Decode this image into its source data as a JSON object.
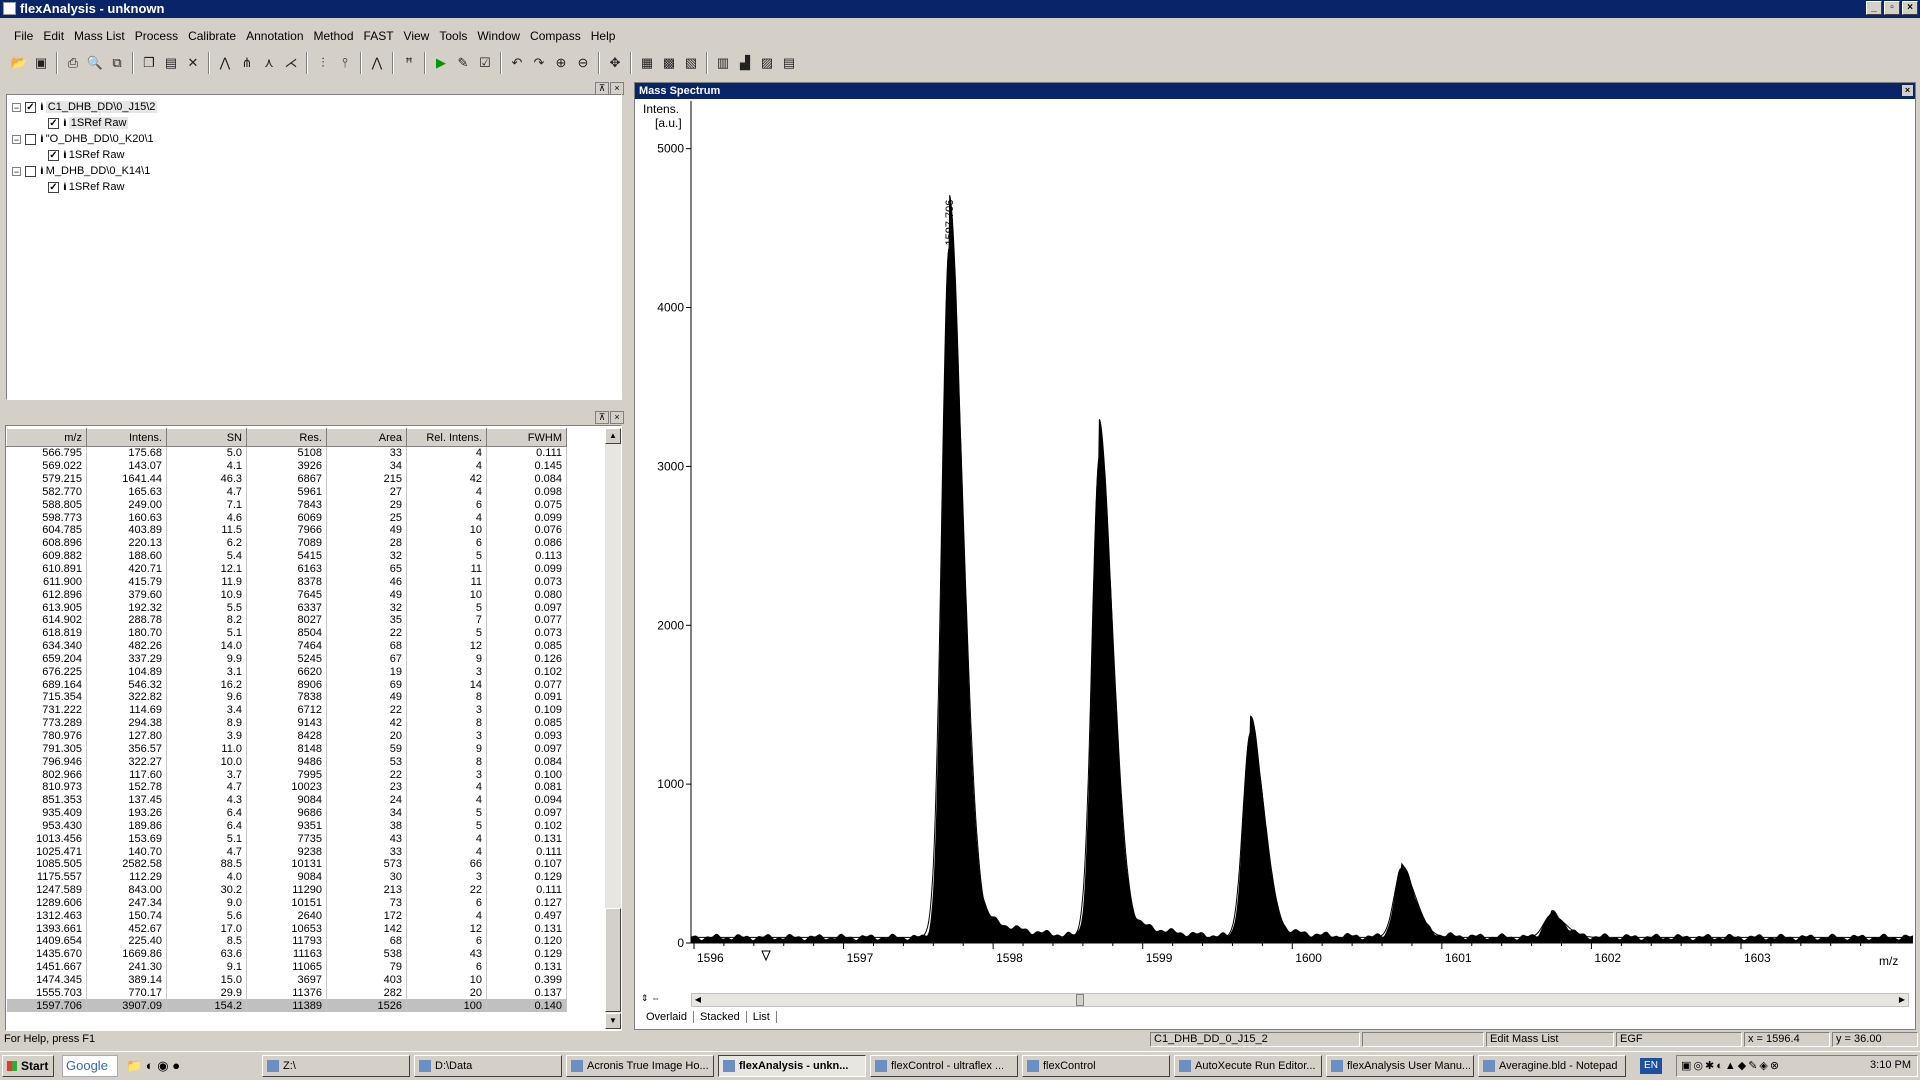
{
  "window": {
    "title": "flexAnalysis - unknown"
  },
  "menu": [
    "File",
    "Edit",
    "Mass List",
    "Process",
    "Calibrate",
    "Annotation",
    "Method",
    "FAST",
    "View",
    "Tools",
    "Window",
    "Compass",
    "Help"
  ],
  "tree": [
    {
      "name": "C1_DHB_DD\\0_J15\\2",
      "child": "1SRef Raw"
    },
    {
      "name": "\"O_DHB_DD\\0_K20\\1",
      "child": "1SRef Raw"
    },
    {
      "name": "M_DHB_DD\\0_K14\\1",
      "child": "1SRef Raw"
    }
  ],
  "peak_table": {
    "headers": [
      "m/z",
      "Intens.",
      "SN",
      "Res.",
      "Area",
      "Rel. Intens.",
      "FWHM"
    ],
    "rows": [
      [
        "566.795",
        "175.68",
        "5.0",
        "5108",
        "33",
        "4",
        "0.111"
      ],
      [
        "569.022",
        "143.07",
        "4.1",
        "3926",
        "34",
        "4",
        "0.145"
      ],
      [
        "579.215",
        "1641.44",
        "46.3",
        "6867",
        "215",
        "42",
        "0.084"
      ],
      [
        "582.770",
        "165.63",
        "4.7",
        "5961",
        "27",
        "4",
        "0.098"
      ],
      [
        "588.805",
        "249.00",
        "7.1",
        "7843",
        "29",
        "6",
        "0.075"
      ],
      [
        "598.773",
        "160.63",
        "4.6",
        "6069",
        "25",
        "4",
        "0.099"
      ],
      [
        "604.785",
        "403.89",
        "11.5",
        "7966",
        "49",
        "10",
        "0.076"
      ],
      [
        "608.896",
        "220.13",
        "6.2",
        "7089",
        "28",
        "6",
        "0.086"
      ],
      [
        "609.882",
        "188.60",
        "5.4",
        "5415",
        "32",
        "5",
        "0.113"
      ],
      [
        "610.891",
        "420.71",
        "12.1",
        "6163",
        "65",
        "11",
        "0.099"
      ],
      [
        "611.900",
        "415.79",
        "11.9",
        "8378",
        "46",
        "11",
        "0.073"
      ],
      [
        "612.896",
        "379.60",
        "10.9",
        "7645",
        "49",
        "10",
        "0.080"
      ],
      [
        "613.905",
        "192.32",
        "5.5",
        "6337",
        "32",
        "5",
        "0.097"
      ],
      [
        "614.902",
        "288.78",
        "8.2",
        "8027",
        "35",
        "7",
        "0.077"
      ],
      [
        "618.819",
        "180.70",
        "5.1",
        "8504",
        "22",
        "5",
        "0.073"
      ],
      [
        "634.340",
        "482.26",
        "14.0",
        "7464",
        "68",
        "12",
        "0.085"
      ],
      [
        "659.204",
        "337.29",
        "9.9",
        "5245",
        "67",
        "9",
        "0.126"
      ],
      [
        "676.225",
        "104.89",
        "3.1",
        "6620",
        "19",
        "3",
        "0.102"
      ],
      [
        "689.164",
        "546.32",
        "16.2",
        "8906",
        "69",
        "14",
        "0.077"
      ],
      [
        "715.354",
        "322.82",
        "9.6",
        "7838",
        "49",
        "8",
        "0.091"
      ],
      [
        "731.222",
        "114.69",
        "3.4",
        "6712",
        "22",
        "3",
        "0.109"
      ],
      [
        "773.289",
        "294.38",
        "8.9",
        "9143",
        "42",
        "8",
        "0.085"
      ],
      [
        "780.976",
        "127.80",
        "3.9",
        "8428",
        "20",
        "3",
        "0.093"
      ],
      [
        "791.305",
        "356.57",
        "11.0",
        "8148",
        "59",
        "9",
        "0.097"
      ],
      [
        "796.946",
        "322.27",
        "10.0",
        "9486",
        "53",
        "8",
        "0.084"
      ],
      [
        "802.966",
        "117.60",
        "3.7",
        "7995",
        "22",
        "3",
        "0.100"
      ],
      [
        "810.973",
        "152.78",
        "4.7",
        "10023",
        "23",
        "4",
        "0.081"
      ],
      [
        "851.353",
        "137.45",
        "4.3",
        "9084",
        "24",
        "4",
        "0.094"
      ],
      [
        "935.409",
        "193.26",
        "6.4",
        "9686",
        "34",
        "5",
        "0.097"
      ],
      [
        "953.430",
        "189.86",
        "6.4",
        "9351",
        "38",
        "5",
        "0.102"
      ],
      [
        "1013.456",
        "153.69",
        "5.1",
        "7735",
        "43",
        "4",
        "0.131"
      ],
      [
        "1025.471",
        "140.70",
        "4.7",
        "9238",
        "33",
        "4",
        "0.111"
      ],
      [
        "1085.505",
        "2582.58",
        "88.5",
        "10131",
        "573",
        "66",
        "0.107"
      ],
      [
        "1175.557",
        "112.29",
        "4.0",
        "9084",
        "30",
        "3",
        "0.129"
      ],
      [
        "1247.589",
        "843.00",
        "30.2",
        "11290",
        "213",
        "22",
        "0.111"
      ],
      [
        "1289.606",
        "247.34",
        "9.0",
        "10151",
        "73",
        "6",
        "0.127"
      ],
      [
        "1312.463",
        "150.74",
        "5.6",
        "2640",
        "172",
        "4",
        "0.497"
      ],
      [
        "1393.661",
        "452.67",
        "17.0",
        "10653",
        "142",
        "12",
        "0.131"
      ],
      [
        "1409.654",
        "225.40",
        "8.5",
        "11793",
        "68",
        "6",
        "0.120"
      ],
      [
        "1435.670",
        "1669.86",
        "63.6",
        "11163",
        "538",
        "43",
        "0.129"
      ],
      [
        "1451.667",
        "241.30",
        "9.1",
        "11065",
        "79",
        "6",
        "0.131"
      ],
      [
        "1474.345",
        "389.14",
        "15.0",
        "3697",
        "403",
        "10",
        "0.399"
      ],
      [
        "1555.703",
        "770.17",
        "29.9",
        "11376",
        "282",
        "20",
        "0.137"
      ],
      [
        "1597.706",
        "3907.09",
        "154.2",
        "11389",
        "1526",
        "100",
        "0.140"
      ]
    ]
  },
  "spectrum": {
    "title": "Mass Spectrum",
    "ylabel_line1": "Intens.",
    "ylabel_line2": "[a.u.]",
    "xlabel": "m/z",
    "peak_label": "1597.706",
    "tabs": [
      "Overlaid",
      "Stacked",
      "List"
    ]
  },
  "chart_data": {
    "type": "line",
    "title": "Mass Spectrum",
    "xlabel": "m/z",
    "ylabel": "Intens. [a.u.]",
    "xlim": [
      1595.98,
      1604.15
    ],
    "ylim": [
      0,
      5300
    ],
    "x_ticks": [
      1596,
      1597,
      1598,
      1599,
      1600,
      1601,
      1602,
      1603
    ],
    "y_ticks": [
      0,
      1000,
      2000,
      3000,
      4000,
      5000
    ],
    "peaks": [
      {
        "mz": 1597.706,
        "intensity": 4340
      },
      {
        "mz": 1598.71,
        "intensity": 3000
      },
      {
        "mz": 1599.72,
        "intensity": 1280
      },
      {
        "mz": 1600.73,
        "intensity": 420
      },
      {
        "mz": 1601.73,
        "intensity": 140
      }
    ],
    "annotations": [
      "1597.706"
    ]
  },
  "status": {
    "help": "For Help, press F1",
    "spectrum": "C1_DHB_DD_0_J15_2",
    "mode": "Edit Mass List",
    "egf": "EGF",
    "x": "x = 1596.4",
    "y": "y = 36.00"
  },
  "taskbar": {
    "start": "Start",
    "google": "Google",
    "items": [
      "Z:\\",
      "D:\\Data",
      "Acronis True Image Ho...",
      "flexAnalysis - unkn...",
      "flexControl - ultraflex ...",
      "flexControl",
      "AutoXecute Run Editor...",
      "flexAnalysis User Manu...",
      "Averagine.bld - Notepad"
    ],
    "lang": "EN",
    "clock": "3:10 PM"
  }
}
